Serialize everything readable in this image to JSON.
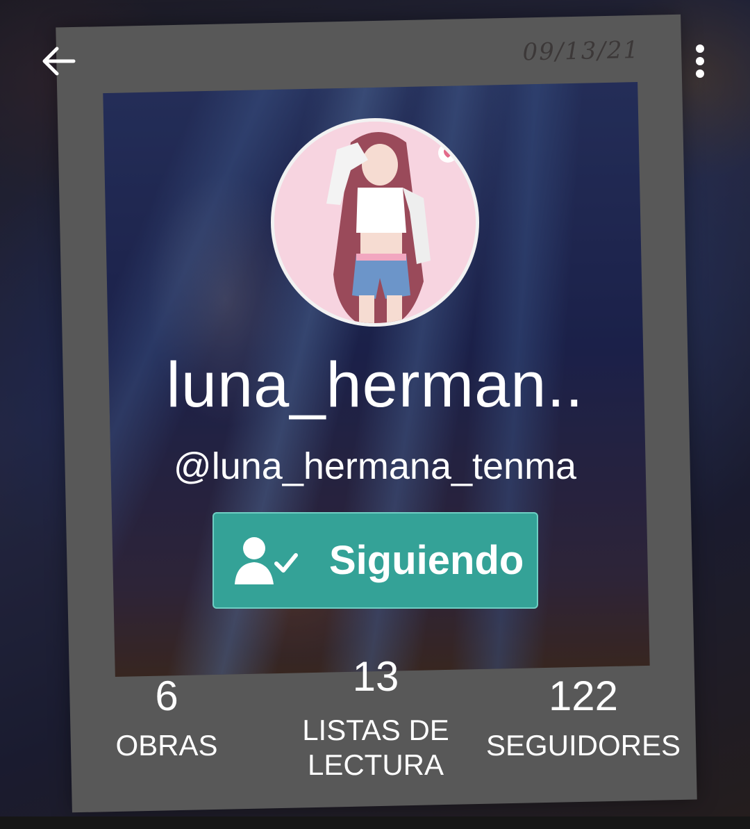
{
  "header": {
    "polaroid_date": "09/13/21"
  },
  "profile": {
    "display_name": "luna_herman..",
    "username": "@luna_hermana_tenma",
    "follow_button_label": "Siguiendo"
  },
  "stats": [
    {
      "value": "6",
      "label": "OBRAS"
    },
    {
      "value": "13",
      "label": "LISTAS DE LECTURA"
    },
    {
      "value": "122",
      "label": "SEGUIDORES"
    }
  ],
  "icons": {
    "back": "arrow-left-icon",
    "more": "more-vertical-icon",
    "following": "user-check-icon"
  },
  "colors": {
    "accent": "#34a297",
    "text": "#ffffff"
  }
}
